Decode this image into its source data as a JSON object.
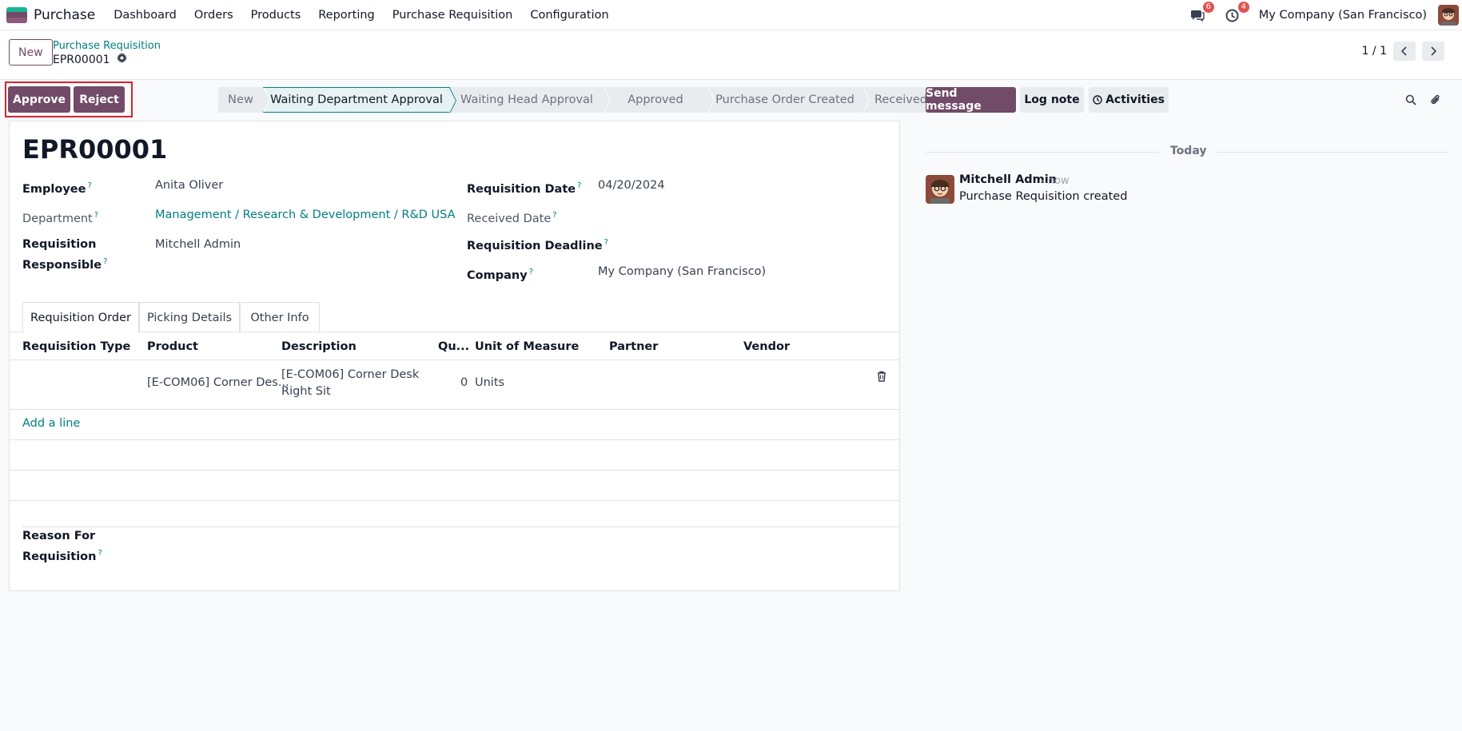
{
  "navbar": {
    "app_name": "Purchase",
    "menu": [
      "Dashboard",
      "Orders",
      "Products",
      "Reporting",
      "Purchase Requisition",
      "Configuration"
    ],
    "messages_count": "6",
    "activities_count": "4",
    "company": "My Company (San Francisco)"
  },
  "control_panel": {
    "new_label": "New",
    "breadcrumb": "Purchase Requisition",
    "record": "EPR00001",
    "pager": "1 / 1"
  },
  "actions": {
    "approve": "Approve",
    "reject": "Reject"
  },
  "statusbar": [
    "New",
    "Waiting Department Approval",
    "Waiting Head Approval",
    "Approved",
    "Purchase Order Created",
    "Received"
  ],
  "status_active": "Waiting Department Approval",
  "form": {
    "title": "EPR00001",
    "employee_label": "Employee",
    "employee": "Anita Oliver",
    "department_label": "Department",
    "department": "Management / Research & Development / R&D USA",
    "responsible_label_1": "Requisition",
    "responsible_label_2": "Responsible",
    "responsible": "Mitchell Admin",
    "req_date_label": "Requisition Date",
    "req_date": "04/20/2024",
    "received_date_label": "Received Date",
    "deadline_label": "Requisition Deadline",
    "company_label": "Company",
    "company": "My Company (San Francisco)",
    "help": "?"
  },
  "tabs": [
    "Requisition Order",
    "Picking Details",
    "Other Info"
  ],
  "table": {
    "headers": [
      "Requisition Type",
      "Product",
      "Description",
      "Qu...",
      "Unit of Measure",
      "Partner",
      "Vendor"
    ],
    "rows": [
      {
        "type": "",
        "product": "[E-COM06] Corner Des...",
        "desc_1": "[E-COM06] Corner Desk",
        "desc_2": "Right Sit",
        "qty": "0",
        "uom": "Units",
        "partner": "",
        "vendor": ""
      }
    ],
    "add_line": "Add a line"
  },
  "reason": {
    "label_1": "Reason For",
    "label_2": "Requisition"
  },
  "chatter": {
    "send_message": "Send message",
    "log_note": "Log note",
    "activities": "Activities",
    "today": "Today",
    "messages": [
      {
        "author": "Mitchell Admin",
        "time": "- now",
        "body": "Purchase Requisition created"
      }
    ]
  },
  "colors": {
    "brand": "#714b67",
    "link": "#017e84",
    "highlight": "#d9232e"
  }
}
